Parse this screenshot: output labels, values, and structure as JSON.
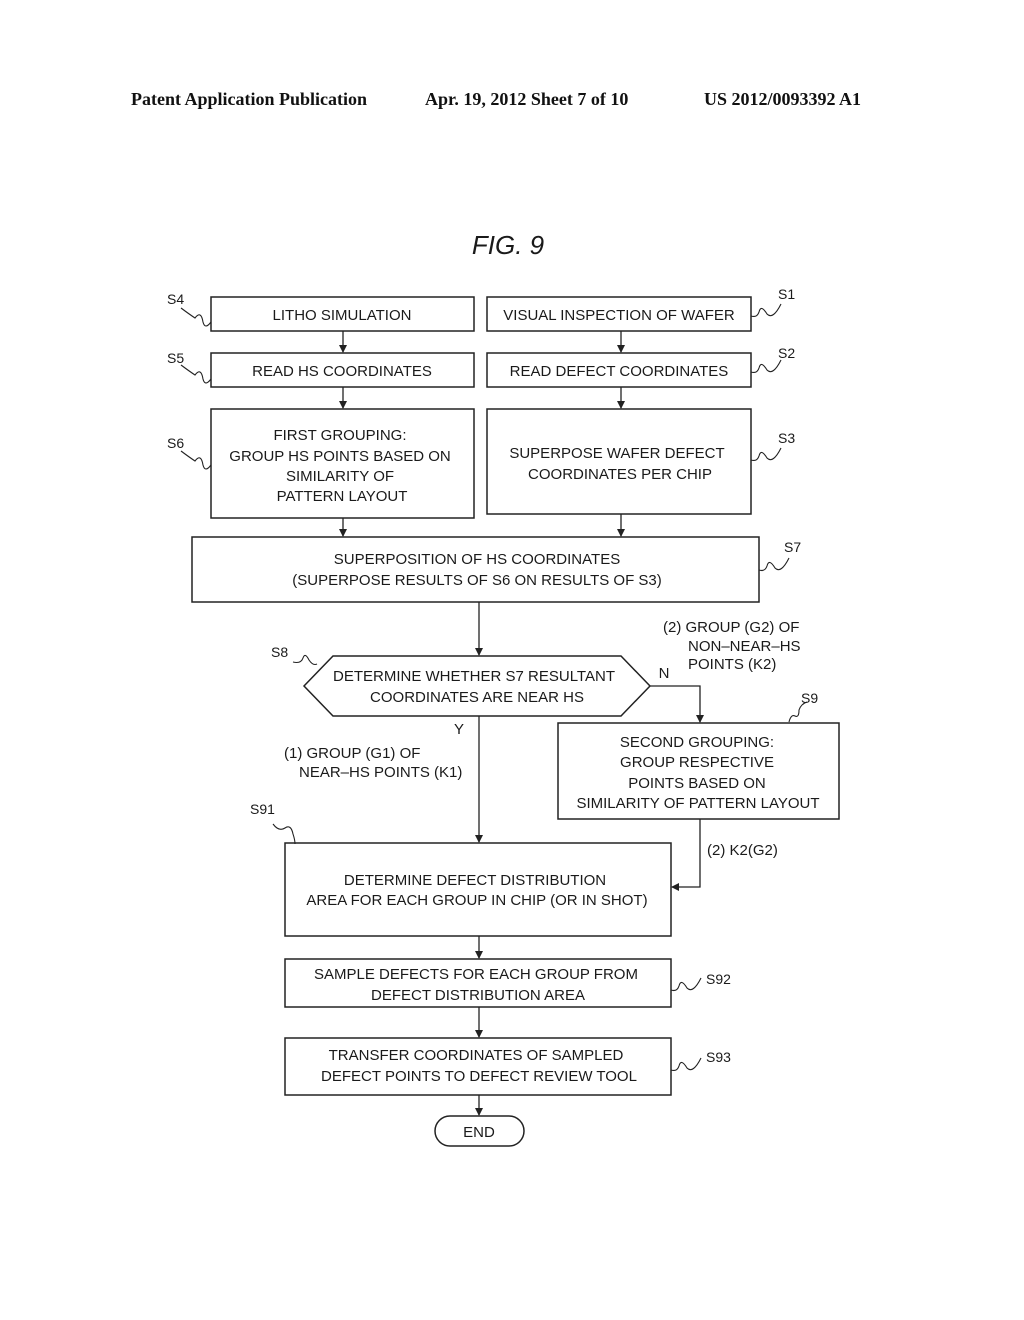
{
  "header": {
    "left": "Patent Application Publication",
    "middle": "Apr. 19, 2012  Sheet 7 of 10",
    "right": "US 2012/0093392 A1"
  },
  "figure_title": "FIG.  9",
  "steps": {
    "S4": {
      "id": "S4",
      "lines": [
        "LITHO SIMULATION"
      ]
    },
    "S5": {
      "id": "S5",
      "lines": [
        "READ HS COORDINATES"
      ]
    },
    "S6": {
      "id": "S6",
      "lines": [
        "FIRST GROUPING:",
        "GROUP HS POINTS BASED ON",
        "SIMILARITY OF",
        "PATTERN LAYOUT"
      ]
    },
    "S1": {
      "id": "S1",
      "lines": [
        "VISUAL INSPECTION OF WAFER"
      ]
    },
    "S2": {
      "id": "S2",
      "lines": [
        "READ DEFECT COORDINATES"
      ]
    },
    "S3": {
      "id": "S3",
      "lines": [
        "SUPERPOSE WAFER DEFECT",
        "COORDINATES PER CHIP"
      ]
    },
    "S7": {
      "id": "S7",
      "lines": [
        "SUPERPOSITION OF HS COORDINATES",
        "(SUPERPOSE RESULTS OF S6 ON RESULTS OF S3)"
      ]
    },
    "S8": {
      "id": "S8",
      "lines": [
        "DETERMINE WHETHER S7 RESULTANT",
        "COORDINATES ARE NEAR HS"
      ]
    },
    "S9": {
      "id": "S9",
      "lines": [
        "SECOND GROUPING:",
        "GROUP RESPECTIVE",
        "POINTS BASED ON",
        "SIMILARITY OF PATTERN LAYOUT"
      ]
    },
    "S91": {
      "id": "S91",
      "lines": [
        "DETERMINE DEFECT DISTRIBUTION",
        "AREA FOR EACH GROUP IN CHIP (OR IN SHOT)"
      ]
    },
    "S92": {
      "id": "S92",
      "lines": [
        "SAMPLE DEFECTS FOR EACH GROUP FROM",
        "DEFECT DISTRIBUTION AREA"
      ]
    },
    "S93": {
      "id": "S93",
      "lines": [
        "TRANSFER COORDINATES OF SAMPLED",
        "DEFECT POINTS TO DEFECT REVIEW TOOL"
      ]
    },
    "END": {
      "lines": [
        "END"
      ]
    }
  },
  "branch_labels": {
    "no": "N",
    "yes": "Y",
    "no_group": [
      "(2) GROUP (G2) OF",
      "NON–NEAR–HS",
      "POINTS (K2)"
    ],
    "yes_group": [
      "(1) GROUP (G1) OF",
      "NEAR–HS POINTS (K1)"
    ],
    "k2": "(2) K2(G2)"
  }
}
